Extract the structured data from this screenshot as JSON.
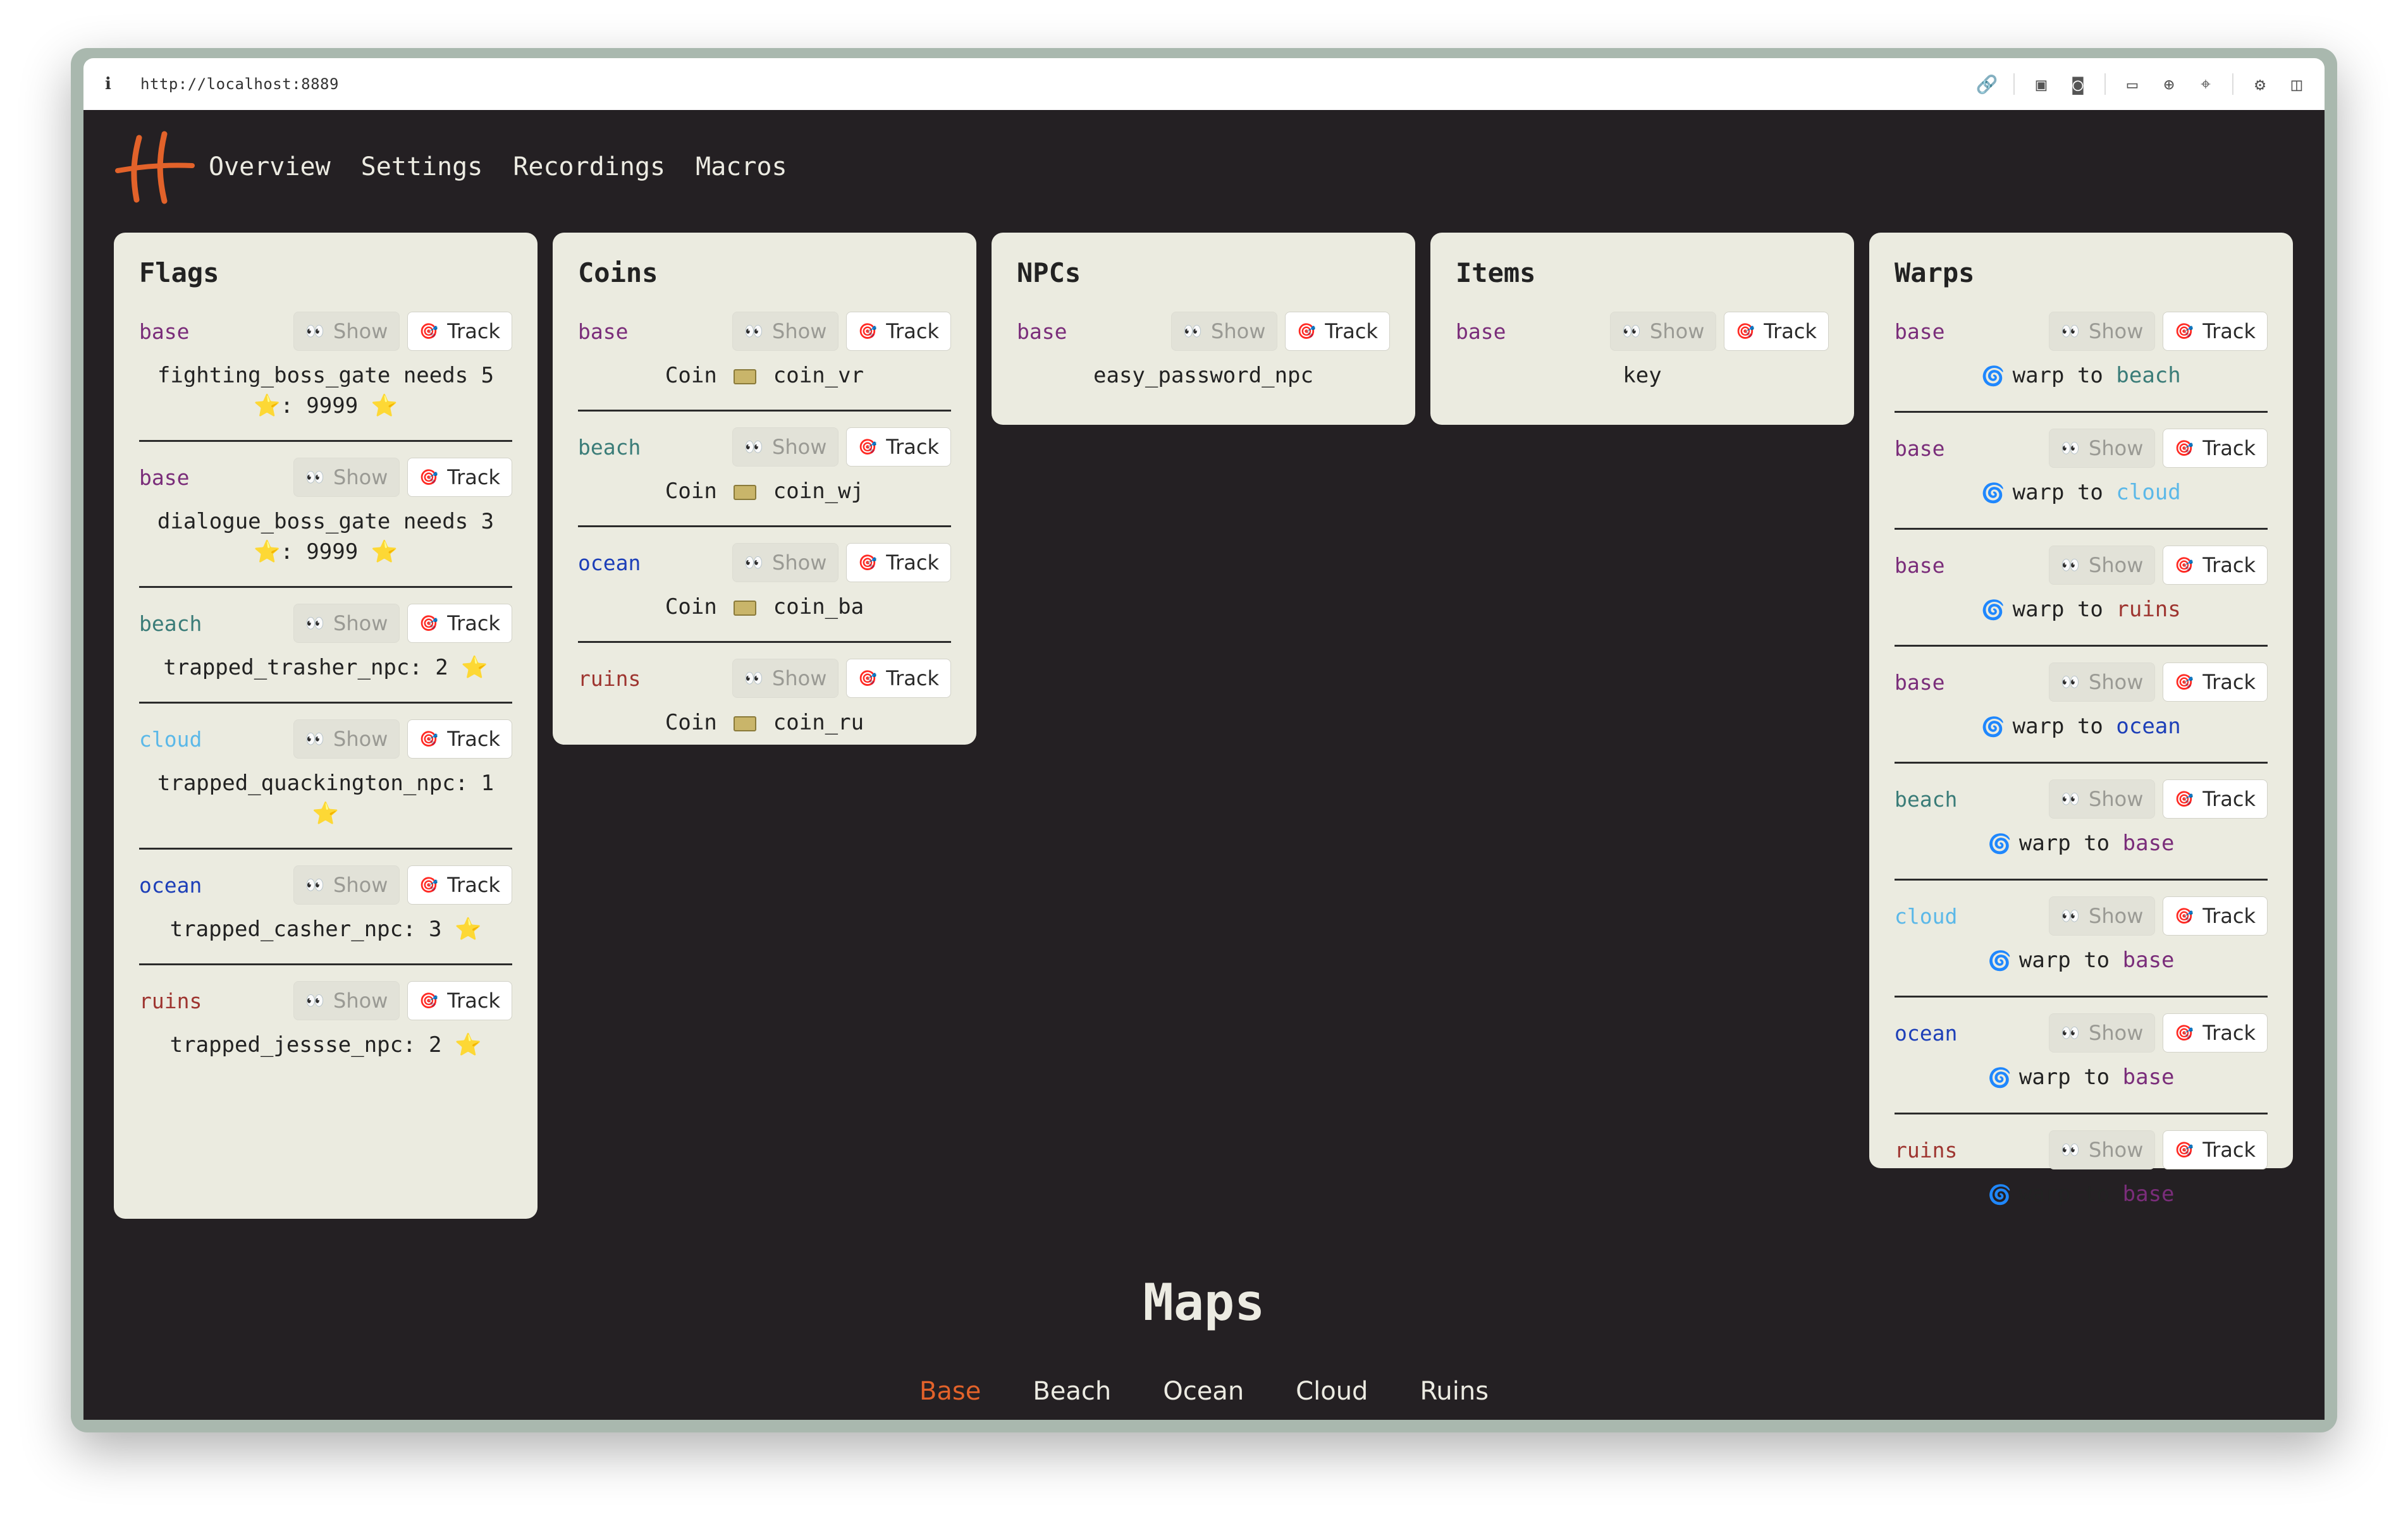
{
  "browser": {
    "info_icon": "info-icon",
    "url": "http://localhost:8889",
    "tools": [
      "link-icon",
      "screenshot-icon",
      "camera-icon",
      "terminal-icon",
      "globe-icon",
      "crosshair-icon",
      "extension-icon",
      "sidebar-icon"
    ]
  },
  "nav": {
    "items": [
      "Overview",
      "Settings",
      "Recordings",
      "Macros"
    ]
  },
  "labels": {
    "show": "Show",
    "track": "Track"
  },
  "colors": {
    "accent": "#e2622a",
    "base": "#7a2d7a",
    "beach": "#3a7c78",
    "cloud": "#5bb8e8",
    "ocean": "#1d3fb8",
    "ruins": "#9e3530",
    "background": "#242023",
    "card": "#ebebe0"
  },
  "flags": {
    "title": "Flags",
    "entries": [
      {
        "tag": "base",
        "text": "fighting_boss_gate needs 5 ⭐: 9999 ⭐"
      },
      {
        "tag": "base",
        "text": "dialogue_boss_gate needs 3 ⭐: 9999 ⭐"
      },
      {
        "tag": "beach",
        "text": "trapped_trasher_npc: 2 ⭐"
      },
      {
        "tag": "cloud",
        "text": "trapped_quackington_npc: 1 ⭐"
      },
      {
        "tag": "ocean",
        "text": "trapped_casher_npc: 3 ⭐"
      },
      {
        "tag": "ruins",
        "text": "trapped_jessse_npc: 2 ⭐"
      }
    ]
  },
  "coins": {
    "title": "Coins",
    "entries": [
      {
        "tag": "base",
        "prefix": "Coin",
        "name": "coin_vr"
      },
      {
        "tag": "beach",
        "prefix": "Coin",
        "name": "coin_wj"
      },
      {
        "tag": "ocean",
        "prefix": "Coin",
        "name": "coin_ba"
      },
      {
        "tag": "ruins",
        "prefix": "Coin",
        "name": "coin_ru"
      }
    ]
  },
  "npcs": {
    "title": "NPCs",
    "entries": [
      {
        "tag": "base",
        "text": "easy_password_npc"
      }
    ]
  },
  "items": {
    "title": "Items",
    "entries": [
      {
        "tag": "base",
        "text": "key"
      }
    ]
  },
  "warps": {
    "title": "Warps",
    "prefix": "warp to",
    "entries": [
      {
        "tag": "base",
        "dest": "beach"
      },
      {
        "tag": "base",
        "dest": "cloud"
      },
      {
        "tag": "base",
        "dest": "ruins"
      },
      {
        "tag": "base",
        "dest": "ocean"
      },
      {
        "tag": "beach",
        "dest": "base"
      },
      {
        "tag": "cloud",
        "dest": "base"
      },
      {
        "tag": "ocean",
        "dest": "base"
      },
      {
        "tag": "ruins",
        "dest": "base"
      }
    ]
  },
  "maps": {
    "title": "Maps",
    "tabs": [
      "Base",
      "Beach",
      "Ocean",
      "Cloud",
      "Ruins"
    ],
    "active": "Base"
  }
}
